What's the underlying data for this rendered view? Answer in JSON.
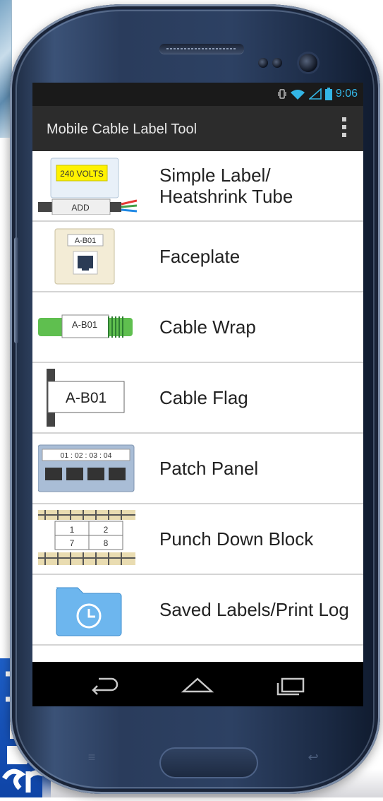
{
  "status_bar": {
    "time": "9:06",
    "icons": [
      "vibrate-icon",
      "wifi-icon",
      "signal-icon",
      "battery-icon"
    ]
  },
  "action_bar": {
    "title": "Mobile Cable Label Tool",
    "overflow_icon": "overflow-menu-icon"
  },
  "thumbs": {
    "simple_label": {
      "top_text": "240 VOLTS",
      "bottom_text": "ADD"
    },
    "faceplate": {
      "text": "A-B01"
    },
    "cable_wrap": {
      "text": "A-B01"
    },
    "cable_flag": {
      "text": "A-B01"
    },
    "patch_panel": {
      "text": "01 : 02 : 03 : 04"
    },
    "punch_down": {
      "cells": [
        "1",
        "2",
        "7",
        "8"
      ]
    }
  },
  "menu": {
    "items": [
      {
        "label": "Simple Label/ Heatshrink Tube"
      },
      {
        "label": "Faceplate"
      },
      {
        "label": "Cable Wrap"
      },
      {
        "label": "Cable Flag"
      },
      {
        "label": "Patch Panel"
      },
      {
        "label": "Punch Down Block"
      },
      {
        "label": "Saved Labels/Print Log"
      }
    ]
  },
  "nav_bar": {
    "icons": [
      "back-icon",
      "home-icon",
      "recent-apps-icon"
    ]
  },
  "colors": {
    "accent": "#33b5e5",
    "action_bar": "#2c2c2c",
    "status_bar": "#1a1a1a",
    "phone_body": "#2d4163"
  }
}
